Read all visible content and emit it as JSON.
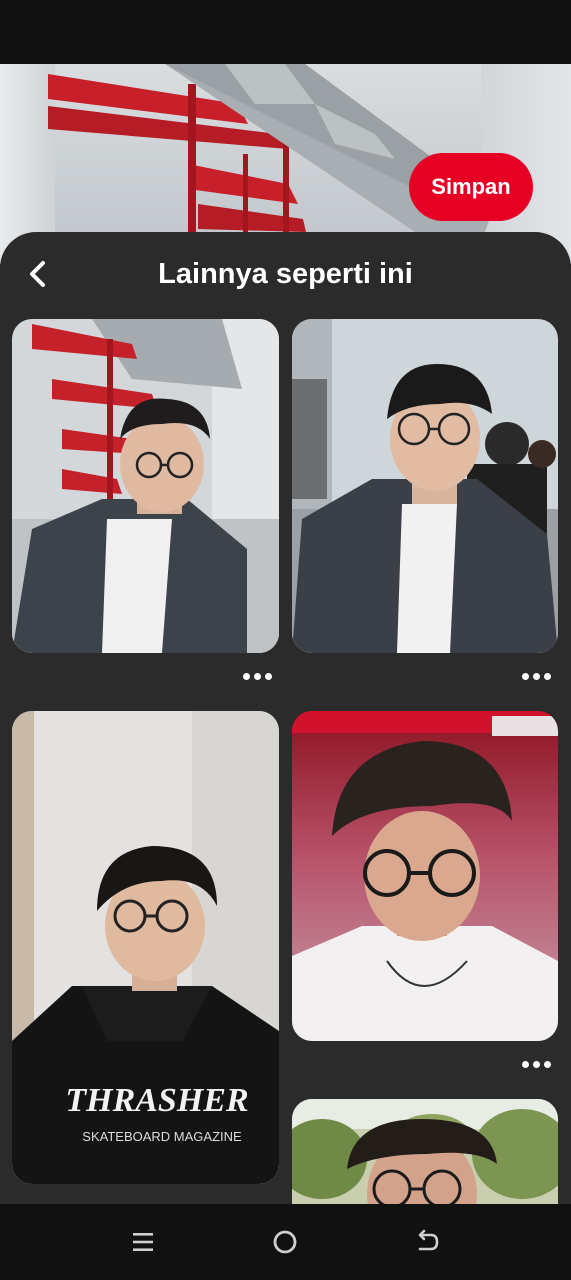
{
  "hero": {
    "save_label": "Simpan"
  },
  "sheet": {
    "title": "Lainnya seperti ini"
  },
  "pins": [
    {
      "name": "pin-denim-jacket-red-stairs"
    },
    {
      "name": "pin-denim-jacket-crowd"
    },
    {
      "name": "pin-thrasher-hoodie"
    },
    {
      "name": "pin-white-tee-red-light"
    },
    {
      "name": "pin-outdoor-trees"
    }
  ],
  "hoodie_text": {
    "brand": "THRASHER",
    "sub": "SKATEBOARD MAGAZINE"
  },
  "colors": {
    "accent": "#e60023",
    "sheet_bg": "#2b2b2b"
  },
  "icons": {
    "back": "chevron-left-icon",
    "more": "more-horizontal-icon",
    "nav_menu": "menu-icon",
    "nav_home": "home-circle-icon",
    "nav_back": "back-arrow-icon"
  }
}
